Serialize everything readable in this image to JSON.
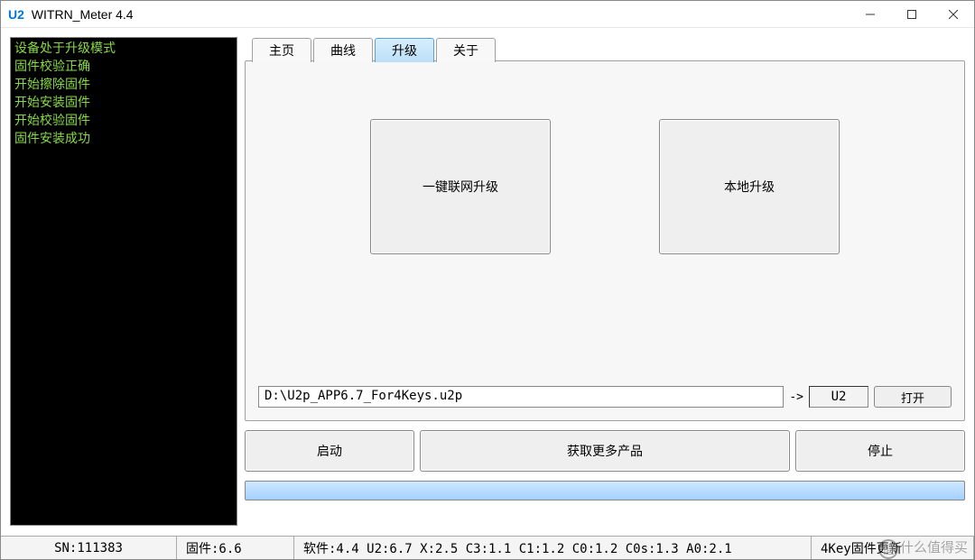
{
  "window": {
    "prefix": "U2",
    "title": "WITRN_Meter 4.4"
  },
  "console": {
    "lines": [
      "设备处于升级模式",
      "固件校验正确",
      "开始擦除固件",
      "开始安装固件",
      "开始校验固件",
      "固件安装成功"
    ]
  },
  "tabs": [
    {
      "label": "主页",
      "active": false
    },
    {
      "label": "曲线",
      "active": false
    },
    {
      "label": "升级",
      "active": true
    },
    {
      "label": "关于",
      "active": false
    }
  ],
  "upgrade": {
    "online_btn": "一键联网升级",
    "local_btn": "本地升级",
    "path": "D:\\U2p_APP6.7_For4Keys.u2p",
    "arrow": "->",
    "device": "U2",
    "open_btn": "打开"
  },
  "actions": {
    "start": "启动",
    "more": "获取更多产品",
    "stop": "停止"
  },
  "status": {
    "sn": "SN:111383",
    "fw": "固件:6.6",
    "sw": "软件:4.4 U2:6.7 X:2.5 C3:1.1 C1:1.2 C0:1.2 C0s:1.3 A0:2.1",
    "last": "4Key固件更新"
  },
  "watermark": {
    "circle": "值",
    "text": "什么值得买"
  }
}
